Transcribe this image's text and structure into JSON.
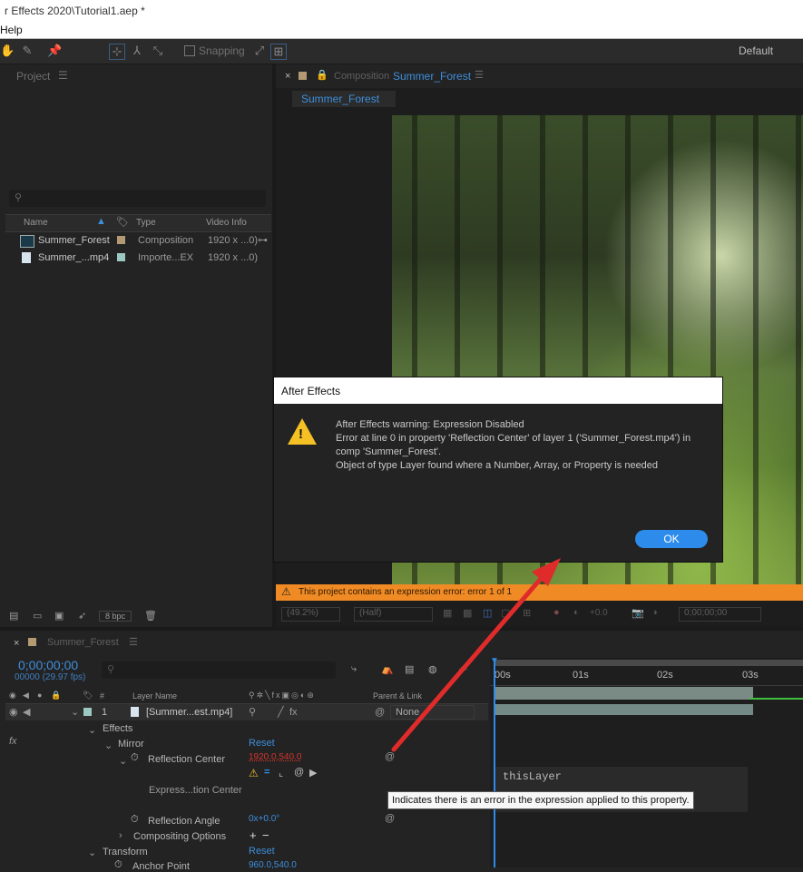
{
  "window": {
    "title": "r Effects 2020\\Tutorial1.aep *"
  },
  "menu": {
    "help": "Help"
  },
  "toolbar": {
    "snapping": "Snapping",
    "workspace": "Default"
  },
  "project": {
    "title": "Project",
    "columns": {
      "name": "Name",
      "type": "Type",
      "video_info": "Video Info"
    },
    "items": [
      {
        "name": "Summer_Forest",
        "type": "Composition",
        "info": "1920 x ...0)",
        "swatch": "#b49a72"
      },
      {
        "name": "Summer_...mp4",
        "type": "Importe...EX",
        "info": "1920 x ...0)",
        "swatch": "#9bc8c0"
      }
    ],
    "bpc": "8 bpc"
  },
  "composition": {
    "panel_prefix": "Composition",
    "name": "Summer_Forest",
    "tab": "Summer_Forest",
    "warning": "This project contains an expression error: error 1 of 1",
    "zoom": "(49.2%)",
    "resolution": "(Half)",
    "exposure": "+0.0",
    "timecode": "0;00;00;00"
  },
  "dialog": {
    "title": "After Effects",
    "lines": [
      "After Effects warning: Expression Disabled",
      "Error at line 0 in property 'Reflection Center' of layer 1 ('Summer_Forest.mp4') in",
      "comp 'Summer_Forest'.",
      "Object of type Layer found where a Number, Array, or Property is needed"
    ],
    "ok": "OK"
  },
  "timeline": {
    "tab": "Summer_Forest",
    "timecode": "0;00;00;00",
    "frames": "00000 (29.97 fps)",
    "col_layer_name": "Layer Name",
    "col_parent": "Parent & Link",
    "col_num": "#",
    "ruler": [
      "00s",
      "01s",
      "02s",
      "03s"
    ],
    "layer": {
      "num": "1",
      "name": "[Summer...est.mp4]",
      "parent": "None"
    },
    "props": {
      "effects": "Effects",
      "mirror": "Mirror",
      "reset1": "Reset",
      "refl_center": "Reflection Center",
      "refl_center_val": "1920.0,540.0",
      "expr_label": "Express...tion Center",
      "expr_text": "thisLayer",
      "refl_angle": "Reflection Angle",
      "refl_angle_val": "0x+0.0°",
      "compositing": "Compositing Options",
      "transform": "Transform",
      "reset2": "Reset",
      "anchor": "Anchor Point",
      "anchor_val": "960.0,540.0"
    },
    "tooltip": "Indicates there is an error in the expression applied to this property."
  },
  "colors": {
    "accent": "#2d8ceb",
    "warning": "#f08a24",
    "error_value": "#d8332a",
    "arrow": "#e02b2b"
  }
}
